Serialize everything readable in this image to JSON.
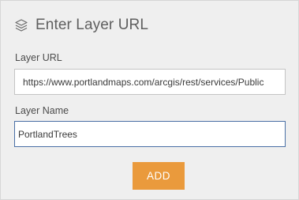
{
  "header": {
    "icon": "layers-icon",
    "title": "Enter Layer URL"
  },
  "form": {
    "url_label": "Layer URL",
    "url_value": "https://www.portlandmaps.com/arcgis/rest/services/Public",
    "name_label": "Layer Name",
    "name_value": "PortlandTrees"
  },
  "actions": {
    "add_label": "ADD"
  },
  "colors": {
    "accent": "#ea9a3c",
    "focus_border": "#4a6fa5"
  }
}
